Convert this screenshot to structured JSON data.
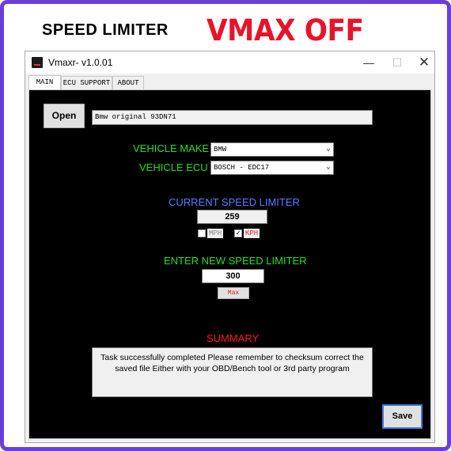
{
  "banner": {
    "title": "SPEED LIMITER",
    "subtitle": "VMAX OFF"
  },
  "window": {
    "title": "Vmaxr- v1.0.01",
    "minimize_glyph": "—",
    "maximize_glyph": "☐",
    "close_glyph": "✕"
  },
  "tabs": [
    {
      "label": "MAIN",
      "active": true
    },
    {
      "label": "ECU SUPPORT",
      "active": false
    },
    {
      "label": "ABOUT",
      "active": false
    }
  ],
  "main": {
    "open_button": "Open",
    "file_path": "Bmw original 93DN71",
    "vehicle_make_label": "VEHICLE MAKE",
    "vehicle_make_value": "BMW",
    "vehicle_ecu_label": "VEHICLE ECU",
    "vehicle_ecu_value": "BOSCH - EDC17",
    "current_limiter_title": "CURRENT SPEED LIMITER",
    "current_limiter_value": "259",
    "unit_mph": "MPH",
    "unit_kph": "KPH",
    "mph_checked": false,
    "kph_checked": true,
    "new_limiter_title": "ENTER NEW SPEED LIMITER",
    "new_limiter_value": "300",
    "max_button": "Max",
    "summary_title": "SUMMARY",
    "summary_text": "Task successfully completed Please remember to checksum correct the saved file Either with your OBD/Bench tool or 3rd party program",
    "save_button": "Save"
  },
  "colors": {
    "frame_border": "#6a3fd8",
    "banner_subtitle": "#e8132a",
    "label_green": "#22e022",
    "current_title_blue": "#5b7bff",
    "summary_red": "#ff1a1a",
    "unit_red": "#e0201f",
    "panel_bg": "#000000"
  },
  "icons": {
    "app": "app-logo-icon",
    "dropdown": "chevron-down-icon",
    "check": "checkmark-icon"
  }
}
